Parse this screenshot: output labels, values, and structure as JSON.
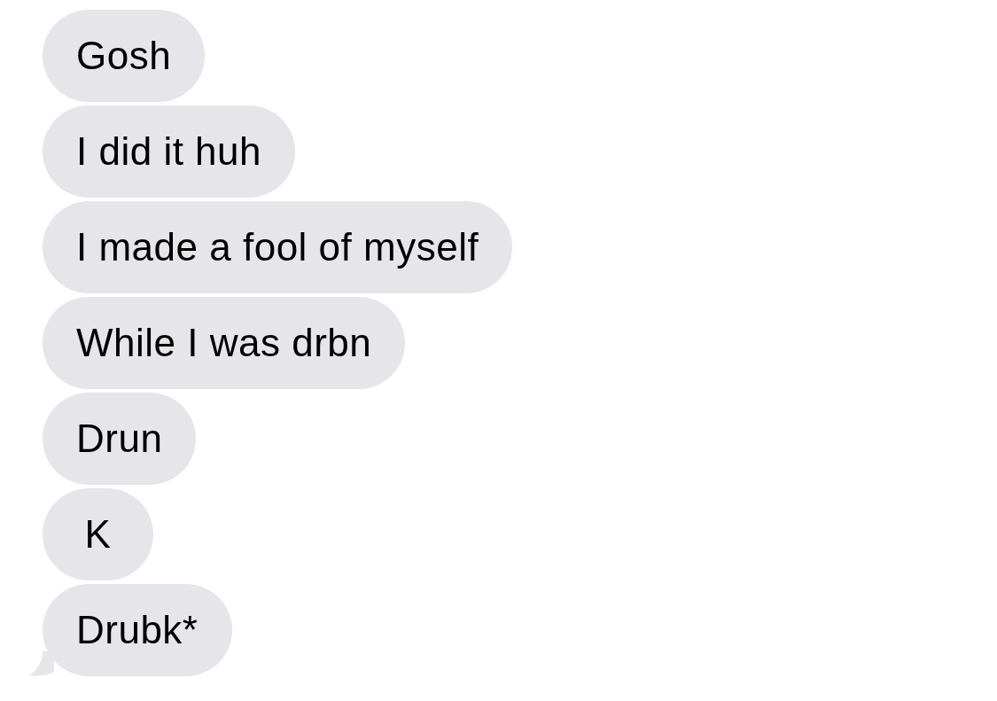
{
  "messages": [
    {
      "text": "Gosh",
      "tail": false
    },
    {
      "text": "I did it huh",
      "tail": false
    },
    {
      "text": "I made a fool of myself",
      "tail": false
    },
    {
      "text": "While I was drbn",
      "tail": false
    },
    {
      "text": "Drun",
      "tail": false
    },
    {
      "text": "K",
      "tail": false
    },
    {
      "text": "Drubk*",
      "tail": true
    }
  ]
}
